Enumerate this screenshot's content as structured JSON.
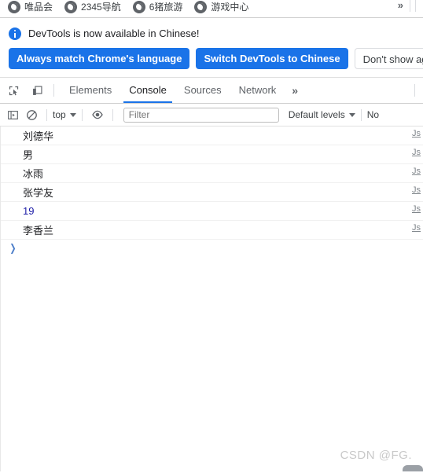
{
  "bookmarks_bar": {
    "items": [
      {
        "label": "唯品会",
        "icon": "generic-site-favicon"
      },
      {
        "label": "2345导航",
        "icon": "generic-site-favicon"
      },
      {
        "label": "6猪旅游",
        "icon": "generic-site-favicon"
      },
      {
        "label": "游戏中心",
        "icon": "generic-site-favicon"
      }
    ],
    "overflow_label": "»"
  },
  "i18n_notification": {
    "icon": "info-icon",
    "message": "DevTools is now available in Chinese!",
    "buttons": [
      {
        "label": "Always match Chrome's language",
        "style": "primary"
      },
      {
        "label": "Switch DevTools to Chinese",
        "style": "primary"
      },
      {
        "label": "Don't show again",
        "style": "secondary"
      }
    ]
  },
  "panel_tabbar": {
    "inspect_icon": "inspect-cursor-icon",
    "device_icon": "device-toolbar-icon",
    "tabs": [
      {
        "label": "Elements",
        "active": false
      },
      {
        "label": "Console",
        "active": true
      },
      {
        "label": "Sources",
        "active": false
      },
      {
        "label": "Network",
        "active": false
      }
    ],
    "more_label": "»"
  },
  "console_toolbar": {
    "sidebar_icon": "console-sidebar-icon",
    "clear_icon": "clear-console-icon",
    "context_selector": "top",
    "eye_icon": "live-expression-icon",
    "filter_placeholder": "Filter",
    "filter_value": "",
    "levels_label": "Default levels",
    "issues_label": "No"
  },
  "console_output": {
    "rows": [
      {
        "text": "刘德华",
        "kind": "string",
        "source": "Js"
      },
      {
        "text": "男",
        "kind": "string",
        "source": "Js"
      },
      {
        "text": "冰雨",
        "kind": "string",
        "source": "Js"
      },
      {
        "text": "张学友",
        "kind": "string",
        "source": "Js"
      },
      {
        "text": "19",
        "kind": "number",
        "source": "Js"
      },
      {
        "text": "李香兰",
        "kind": "string",
        "source": "Js"
      }
    ],
    "prompt_caret": "❯"
  },
  "watermark": {
    "text": "CSDN @FG."
  },
  "colors": {
    "accent_blue": "#1a73e8",
    "number_blue": "#1a1aa6",
    "text_primary": "#202124",
    "text_secondary": "#5f6368",
    "border": "#e0e0e0"
  }
}
